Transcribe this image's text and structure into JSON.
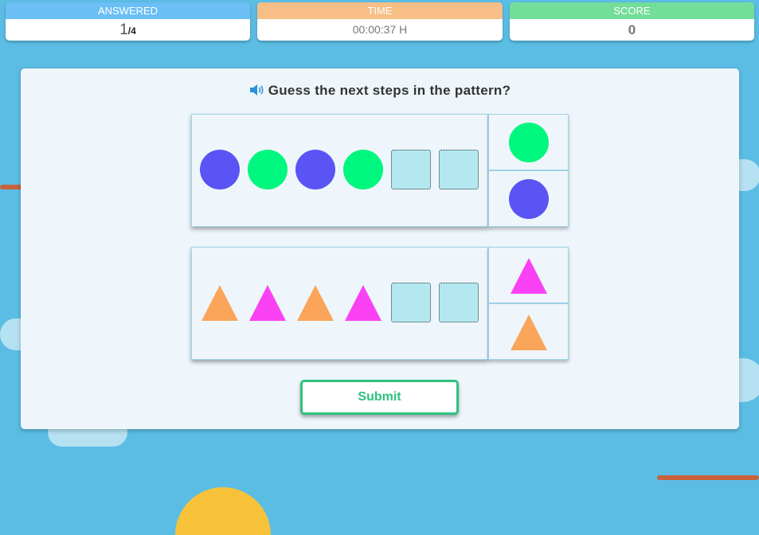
{
  "status": {
    "answered": {
      "label": "ANSWERED",
      "current": "1",
      "total": "/4"
    },
    "time": {
      "label": "TIME",
      "value": "00:00:37 H"
    },
    "score": {
      "label": "SCORE",
      "value": "0"
    }
  },
  "question": {
    "icon": "speaker-icon",
    "text": "Guess the next steps in the pattern?"
  },
  "colors": {
    "blue": "#5a54f5",
    "green": "#00f77f",
    "orange": "#fba55b",
    "magenta": "#fb41f4",
    "slot": "#b3e8f0",
    "accent": "#2ec27e"
  },
  "patterns": [
    {
      "shape": "circle",
      "sequence": [
        "blue",
        "green",
        "blue",
        "green"
      ],
      "empty_slots": 2,
      "options": [
        "green",
        "blue"
      ]
    },
    {
      "shape": "triangle",
      "sequence": [
        "orange",
        "magenta",
        "orange",
        "magenta"
      ],
      "empty_slots": 2,
      "options": [
        "magenta",
        "orange"
      ]
    }
  ],
  "submit": {
    "label": "Submit"
  }
}
